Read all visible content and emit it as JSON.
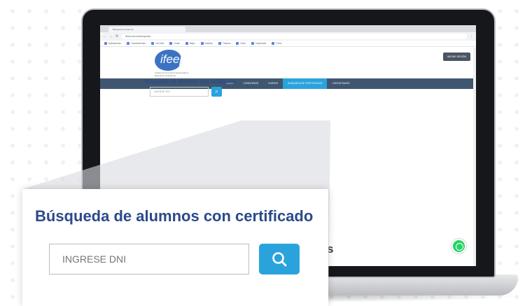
{
  "browser": {
    "tab_title": "Búsqueda de alumnos",
    "url": "ifeep.edu.bo/busqueda",
    "bookmarks": [
      "Aplicaciones",
      "Transferencias",
      "YouTube",
      "Gmail",
      "Maps",
      "Noticias",
      "Traducir",
      "Drive",
      "Calendario",
      "Fotos"
    ]
  },
  "site": {
    "logo": "ifeep",
    "logo_subtitle": "Instituto de Formación Empresarial y Educación Profesional",
    "login_label": "INICIAR SESIÓN",
    "nav": [
      {
        "label": "INICIO"
      },
      {
        "label": "CONOCENOS"
      },
      {
        "label": "CURSOS"
      },
      {
        "label": "BUSQUEDA DE CERTIFICADOS"
      },
      {
        "label": "CONTÁCTANOS"
      }
    ],
    "search_title": "Búsqueda de alumnos con certificado",
    "search_placeholder": "INGRESE DNI"
  },
  "zoom": {
    "title": "Búsqueda de alumnos con certificado",
    "placeholder": "INGRESE DNI",
    "partial_text": "s"
  },
  "colors": {
    "brand_blue": "#2aa3dc",
    "title_blue": "#2b4a8a",
    "nav_bg": "#3f5670",
    "whatsapp": "#25d366"
  },
  "icons": {
    "search": "search-icon",
    "whatsapp": "whatsapp-icon"
  }
}
